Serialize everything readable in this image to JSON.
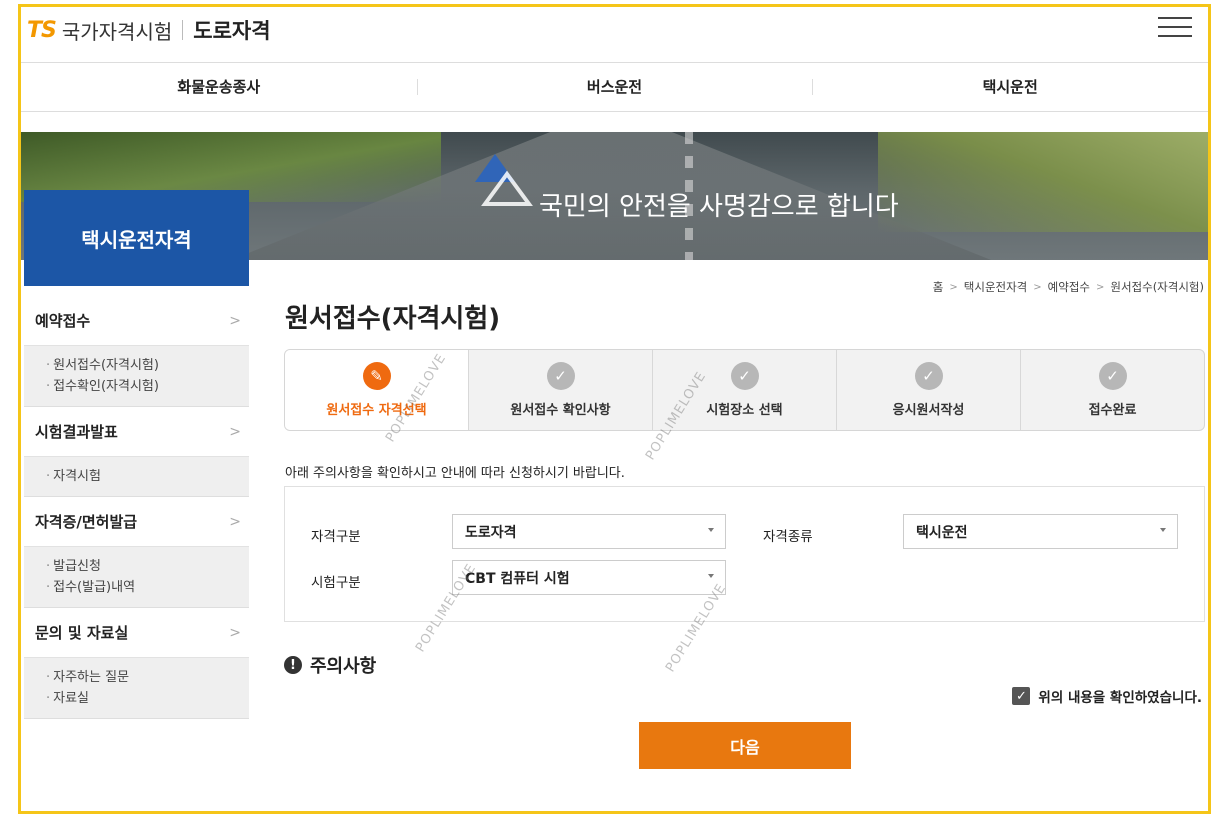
{
  "header": {
    "logo_mark": "TS",
    "logo_name": "국가자격시험",
    "section_name": "도로자격"
  },
  "topnav": [
    "화물운송종사",
    "버스운전",
    "택시운전"
  ],
  "banner": {
    "slogan": "국민의 안전을 사명감으로 합니다"
  },
  "sidebar": {
    "title": "택시운전자격",
    "groups": [
      {
        "label": "예약접수",
        "items": [
          "원서접수(자격시험)",
          "접수확인(자격시험)"
        ]
      },
      {
        "label": "시험결과발표",
        "items": [
          "자격시험"
        ]
      },
      {
        "label": "자격증/면허발급",
        "items": [
          "발급신청",
          "접수(발급)내역"
        ]
      },
      {
        "label": "문의 및 자료실",
        "items": [
          "자주하는 질문",
          "자료실"
        ]
      }
    ]
  },
  "breadcrumb": [
    "홈",
    "택시운전자격",
    "예약접수",
    "원서접수(자격시험)"
  ],
  "page_title": "원서접수(자격시험)",
  "steps": [
    {
      "label": "원서접수 자격선택",
      "active": true
    },
    {
      "label": "원서접수 확인사항",
      "active": false
    },
    {
      "label": "시험장소 선택",
      "active": false
    },
    {
      "label": "응시원서작성",
      "active": false
    },
    {
      "label": "접수완료",
      "active": false
    }
  ],
  "notice": "아래 주의사항을 확인하시고 안내에 따라 신청하시기 바랍니다.",
  "form": {
    "qual_type_label": "자격구분",
    "qual_type_value": "도로자격",
    "qual_kind_label": "자격종류",
    "qual_kind_value": "택시운전",
    "exam_type_label": "시험구분",
    "exam_type_value": "CBT 컴퓨터 시험"
  },
  "caution_title": "주의사항",
  "confirm_label": "위의 내용을 확인하였습니다.",
  "confirm_checked": true,
  "next_label": "다음",
  "watermark": "POPLIMELOVE",
  "colors": {
    "accent": "#e8780f",
    "brand_blue": "#1c56a6",
    "frame": "#f5c518"
  }
}
